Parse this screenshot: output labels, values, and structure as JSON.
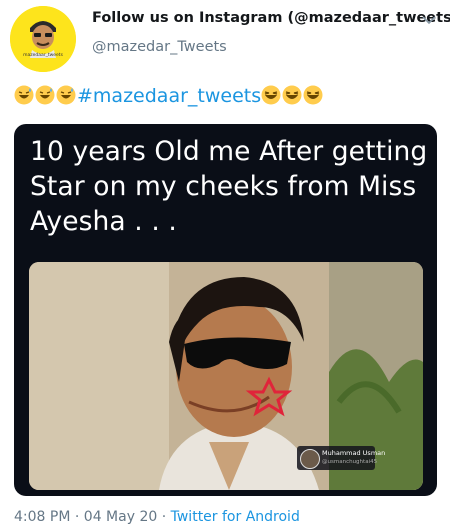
{
  "tweet": {
    "display_name": "Follow us on Instagram (@mazedaar_tweets)",
    "handle": "@mazedar_Tweets",
    "avatar": {
      "label": "mazedaar_tweets",
      "background": "#fde41c"
    },
    "text": {
      "leading_emoji": [
        "grinning-sweat-emoji",
        "grinning-sweat-emoji",
        "grinning-sweat-emoji"
      ],
      "hashtag": "#mazedaar_tweets",
      "trailing_emoji": [
        "laughing-emoji",
        "laughing-emoji",
        "laughing-emoji"
      ]
    },
    "media": {
      "caption": "10 years Old me After getting Star on my cheeks from Miss Ayesha . . .",
      "watermark_name": "Muhammad Usman",
      "watermark_sub": "@usmanchughtai45"
    },
    "meta": {
      "time": "4:08 PM",
      "separator": "·",
      "date": "04 May 20",
      "source": "Twitter for Android"
    },
    "colors": {
      "link": "#1b95e0",
      "muted": "#657786",
      "card_bg": "#0a0e17"
    }
  }
}
